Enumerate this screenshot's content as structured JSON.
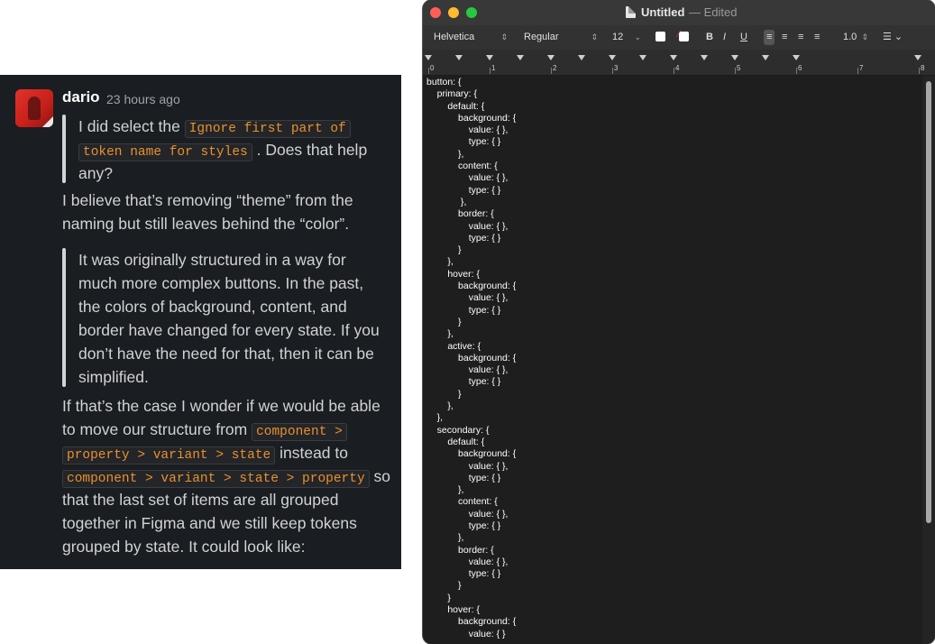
{
  "chat": {
    "author": "dario",
    "timestamp": "23 hours ago",
    "quote1": {
      "line1_text": "I did select the ",
      "line1_code": "Ignore first part of",
      "line2_code": "token name for styles",
      "line2_text": " . Does that help",
      "line3_text": "any?"
    },
    "para1": [
      "I believe that’s removing “theme” from the",
      "naming but still leaves behind the “color”."
    ],
    "quote2": [
      "It was originally structured in a way for",
      "much more complex buttons. In the past,",
      "the colors of background, content, and",
      "border have changed for every state. If you",
      "don’t have the need for that, then it can be",
      "simplified."
    ],
    "para2": {
      "line1": "If that’s the case I wonder if we would be able",
      "line2_text": "to move our structure from ",
      "line2_code": "component >",
      "line3_code": "property > variant > state",
      "line3_text": " instead to",
      "line4_code": "component > variant > state > property",
      "line4_text": " so",
      "line5": "that the last set of items are all grouped",
      "line6": "together in Figma and we still keep tokens",
      "line7": "grouped by state. It could look like:"
    }
  },
  "textedit": {
    "title": "Untitled",
    "status": "— Edited",
    "font_family": "Helvetica",
    "font_style": "Regular",
    "font_size": "12",
    "bold": "B",
    "italic": "I",
    "underline": "U",
    "line_spacing": "1.0",
    "ruler_numbers": [
      "0",
      "1",
      "2",
      "3",
      "4",
      "5",
      "6",
      "7",
      "8"
    ],
    "text_color": "#ffffff",
    "highlight_color": "#ffffff",
    "content": "button: {\n\tprimary: {\n\t\tdefault: {\n\t\t\tbackground: {\n\t\t\t\tvalue: { },\n\t\t\t\ttype: { }\n\t\t\t},\n\t\t\tcontent: {\n\t\t\t\tvalue: { },\n\t\t\t\ttype: { }\n\t\t\t },\n\t\t\tborder: {\n\t\t\t\tvalue: { },\n\t\t\t\ttype: { }\n\t\t\t}\n\t\t},\n\t\thover: {\n\t\t\tbackground: {\n\t\t\t\tvalue: { },\n\t\t\t\ttype: { }\n\t\t\t}\n\t\t},\n\t\tactive: {\n\t\t\tbackground: {\n\t\t\t\tvalue: { },\n\t\t\t\ttype: { }\n\t\t\t}\n\t\t},\n\t},\n\tsecondary: {\n\t\tdefault: {\n\t\t\tbackground: {\n\t\t\t\tvalue: { },\n\t\t\t\ttype: { }\n\t\t\t},\n\t\t\tcontent: {\n\t\t\t\tvalue: { },\n\t\t\t\ttype: { }\n\t\t\t},\n\t\t\tborder: {\n\t\t\t\tvalue: { },\n\t\t\t\ttype: { }\n\t\t\t}\n\t\t}\n\t\thover: {\n\t\t\tbackground: {\n\t\t\t\tvalue: { }"
  },
  "colors": {
    "chat_bg": "#1a1d21",
    "code_accent": "#e8912d",
    "close": "#ff5f57",
    "minimize": "#febc2e",
    "maximize": "#28c840"
  }
}
